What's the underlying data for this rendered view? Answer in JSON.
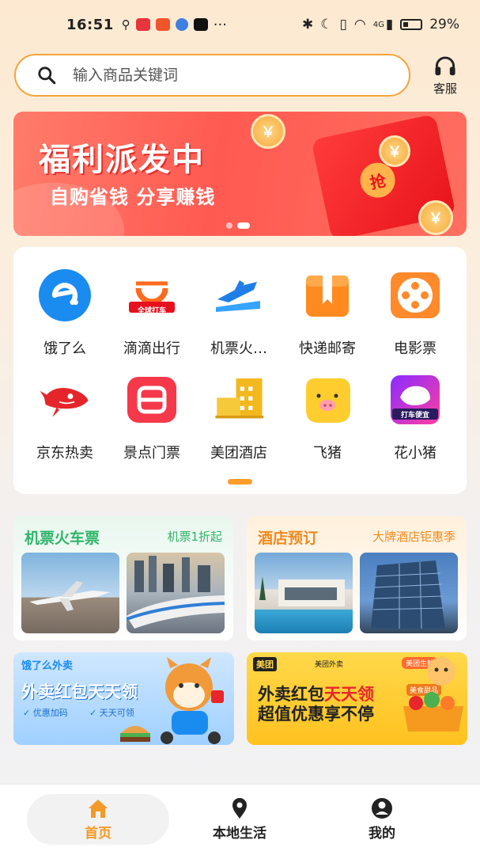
{
  "status_bar": {
    "time": "16:51",
    "more": "···",
    "signal": "4G",
    "battery": "29%"
  },
  "search": {
    "placeholder": "输入商品关键词"
  },
  "customer_service": {
    "label": "客服"
  },
  "banner": {
    "title": "福利派发中",
    "subtitle": "自购省钱 分享赚钱",
    "coin_text": "￥",
    "envelope_text": "抢"
  },
  "services": [
    {
      "label": "饿了么",
      "icon": "eleme-icon"
    },
    {
      "label": "滴滴出行",
      "icon": "didi-icon",
      "badge": "全球打车"
    },
    {
      "label": "机票火…",
      "icon": "plane-icon"
    },
    {
      "label": "快递邮寄",
      "icon": "package-icon"
    },
    {
      "label": "电影票",
      "icon": "film-reel-icon"
    },
    {
      "label": "京东热卖",
      "icon": "jd-dog-icon"
    },
    {
      "label": "景点门票",
      "icon": "ticket-icon"
    },
    {
      "label": "美团酒店",
      "icon": "hotel-icon"
    },
    {
      "label": "飞猪",
      "icon": "fliggy-icon"
    },
    {
      "label": "花小猪",
      "icon": "huaxiaozhu-icon",
      "badge": "打车便宜"
    }
  ],
  "promos": {
    "travel": {
      "title": "机票火车票",
      "tag": "机票1折起"
    },
    "hotel": {
      "title": "酒店预订",
      "tag": "大牌酒店钜惠季"
    }
  },
  "ads": {
    "eleme": {
      "brand": "饿了么外卖",
      "title": "外卖红包天天领",
      "point1": "优惠加码",
      "point2": "天天可领"
    },
    "meituan": {
      "brand": "美团",
      "brand2": "美团外卖",
      "badge": "美团生鲜",
      "title_part1": "外卖红包",
      "title_part2": "天天领",
      "title_line2": "超值优惠享不停",
      "badge2": "美食甜品"
    }
  },
  "nav": {
    "home": "首页",
    "local": "本地生活",
    "mine": "我的"
  },
  "colors": {
    "accent": "#f39a26",
    "banner_red": "#ff5a52",
    "travel_green": "#2fb56a",
    "hotel_orange": "#f08a1d"
  }
}
